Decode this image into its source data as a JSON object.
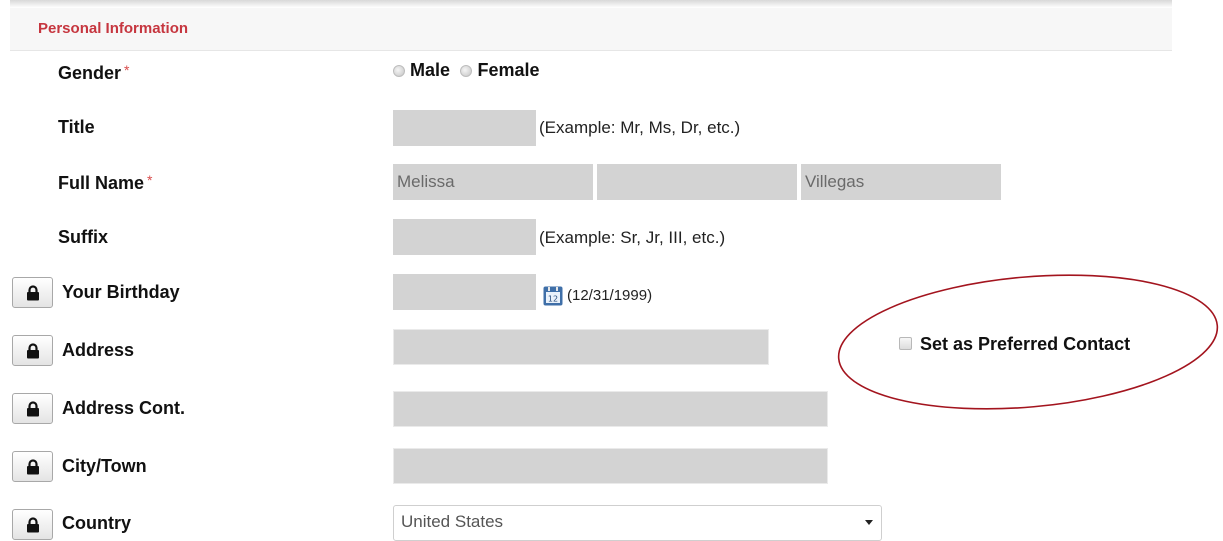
{
  "section": {
    "title": "Personal Information"
  },
  "required_marker": "*",
  "gender": {
    "label": "Gender",
    "options": [
      {
        "label": "Male",
        "selected": false
      },
      {
        "label": "Female",
        "selected": false
      }
    ]
  },
  "title_field": {
    "label": "Title",
    "value": "",
    "hint": "(Example: Mr, Ms, Dr, etc.)"
  },
  "full_name": {
    "label": "Full Name",
    "first": "Melissa",
    "middle": "",
    "last": "Villegas"
  },
  "suffix": {
    "label": "Suffix",
    "value": "",
    "hint": "(Example: Sr, Jr, III, etc.)"
  },
  "birthday": {
    "label": "Your Birthday",
    "value": "",
    "format_hint": "(12/31/1999)",
    "calendar_day": "12"
  },
  "address": {
    "label": "Address",
    "value": ""
  },
  "preferred_contact": {
    "label": "Set as Preferred Contact",
    "checked": false
  },
  "address_cont": {
    "label": "Address Cont.",
    "value": ""
  },
  "city": {
    "label": "City/Town",
    "value": ""
  },
  "country": {
    "label": "Country",
    "selected": "United States"
  },
  "colors": {
    "accent": "#c6363f",
    "field_bg": "#d3d3d3",
    "annotation": "#a3141e"
  },
  "icons": {
    "lock": "lock-icon",
    "calendar": "calendar-icon"
  }
}
